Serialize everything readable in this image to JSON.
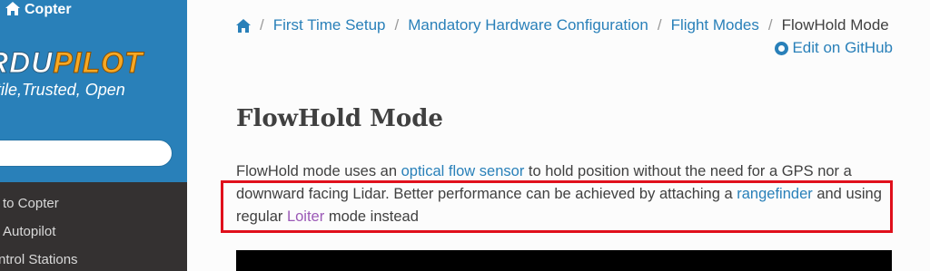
{
  "sidebar": {
    "project_name": "Copter",
    "logo_left": "RDU",
    "logo_right": "PILOT",
    "tagline": "tile,Trusted, Open",
    "nav_items": [
      "to Copter",
      "Autopilot",
      "ntrol Stations"
    ]
  },
  "breadcrumb": {
    "items": [
      "First Time Setup",
      "Mandatory Hardware Configuration",
      "Flight Modes"
    ],
    "current": "FlowHold Mode",
    "separator": "/"
  },
  "edit_link": "Edit on GitHub",
  "page_title": "FlowHold Mode",
  "paragraph": {
    "t1": "FlowHold mode uses an ",
    "link1": "optical flow sensor",
    "t2": " to hold position without the need for a GPS nor a downward facing Lidar. Better performance can be achieved by attaching a ",
    "link2": "rangefinder",
    "t3": " and using regular ",
    "link3": "Loiter",
    "t4": " mode instead"
  },
  "colors": {
    "sidebar_top": "#2980b9",
    "sidebar_bg": "#343131",
    "link": "#2980b9",
    "visited_link": "#9b59b6",
    "highlight": "#e0101c"
  }
}
